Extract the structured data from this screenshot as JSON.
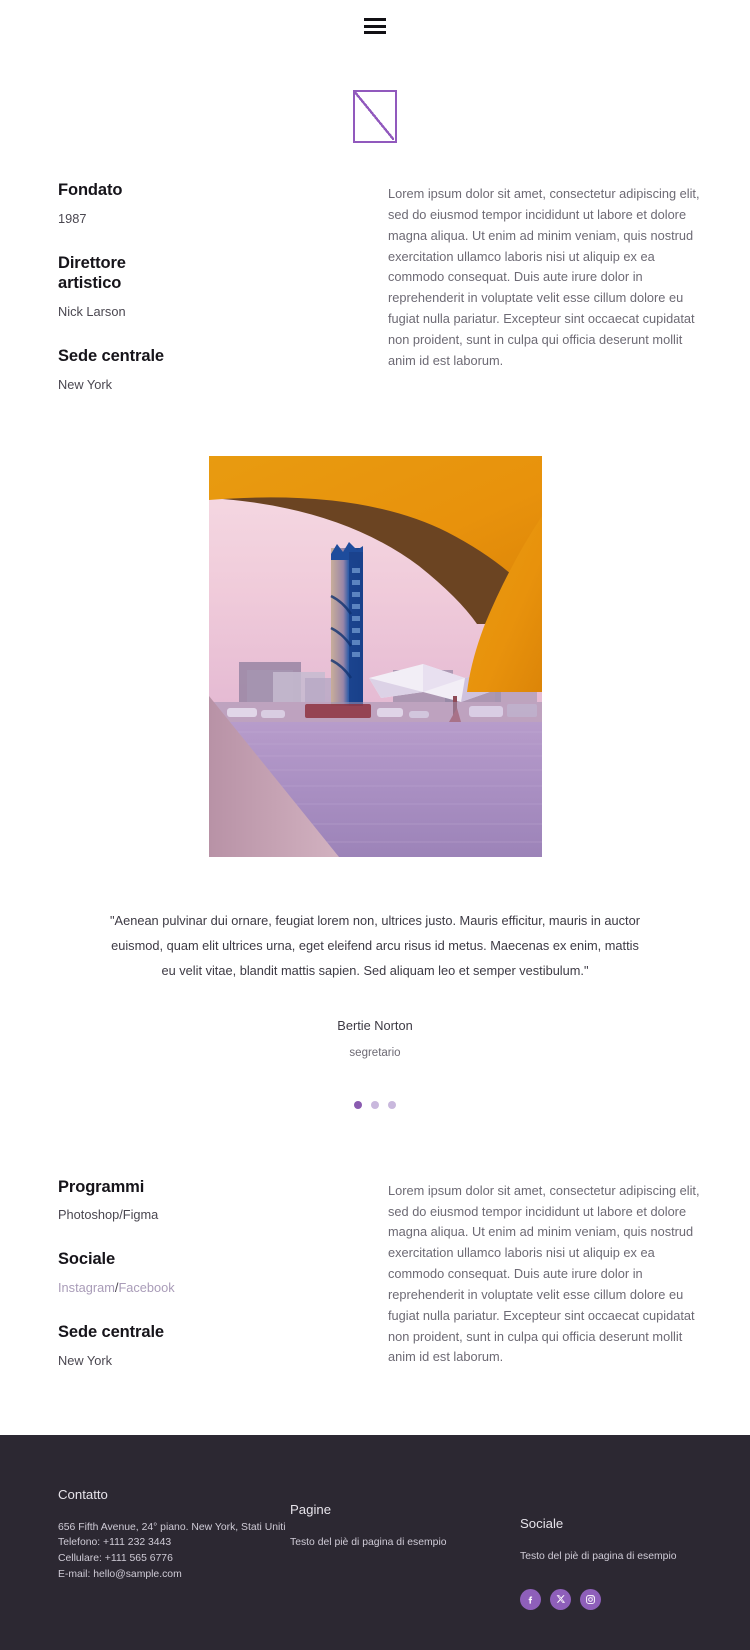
{
  "header": {
    "menu_icon": "hamburger-menu-icon"
  },
  "logo": {
    "icon": "square-diagonal-logo-mark",
    "color": "#9159bd"
  },
  "info_top": {
    "left": [
      {
        "label": "Fondato",
        "value": "1987"
      },
      {
        "label": "Direttore artistico",
        "value": "Nick Larson"
      },
      {
        "label": "Sede centrale",
        "value": "New York"
      }
    ],
    "body": "Lorem ipsum dolor sit amet, consectetur adipiscing elit, sed do eiusmod tempor incididunt ut labore et dolore magna aliqua. Ut enim ad minim veniam, quis nostrud exercitation ullamco laboris nisi ut aliquip ex ea commodo consequat. Duis aute irure dolor in reprehenderit in voluptate velit esse cillum dolore eu fugiat nulla pariatur. Excepteur sint occaecat cupidatat non proident, sunt in culpa qui officia deserunt mollit anim id est laborum."
  },
  "hero": {
    "alt": "Cityscape at sunset with blue skyscraper, waterfront and orange curved overlay",
    "colors": {
      "orange": "#E8920C",
      "dark_arc": "#5C3A1E",
      "sky_pink": "#F2D4DD",
      "tower_blue": "#1F4F9E",
      "water": "#B29AC8",
      "foreground_mauve": "#C9A8B8"
    }
  },
  "testimonial": {
    "quote": "\"Aenean pulvinar dui ornare, feugiat lorem non, ultrices justo. Mauris efficitur, mauris in auctor euismod, quam elit ultrices urna, eget eleifend arcu risus id metus. Maecenas ex enim, mattis eu velit vitae, blandit mattis sapien. Sed aliquam leo et semper vestibulum.\"",
    "author": "Bertie Norton",
    "role": "segretario",
    "dots": [
      {
        "active": true
      },
      {
        "active": false
      },
      {
        "active": false
      }
    ],
    "active_color": "#8a5bb0",
    "inactive_color": "#c9b8dd"
  },
  "info_bottom": {
    "left": [
      {
        "label": "Programmi",
        "value": "Photoshop/Figma"
      },
      {
        "label": "Sociale",
        "value": "Instagram/Facebook"
      },
      {
        "label": "Sede centrale",
        "value": "New York"
      }
    ],
    "social_links": {
      "first": "Instagram",
      "separator": "/",
      "second": "Facebook",
      "color": "#a99cb8"
    },
    "body": "Lorem ipsum dolor sit amet, consectetur adipiscing elit, sed do eiusmod tempor incididunt ut labore et dolore magna aliqua. Ut enim ad minim veniam, quis nostrud exercitation ullamco laboris nisi ut aliquip ex ea commodo consequat. Duis aute irure dolor in reprehenderit in voluptate velit esse cillum dolore eu fugiat nulla pariatur. Excepteur sint occaecat cupidatat non proident, sunt in culpa qui officia deserunt mollit anim id est laborum."
  },
  "footer": {
    "background": "#2c2832",
    "contact": {
      "title": "Contatto",
      "address": "656 Fifth Avenue, 24° piano. New York, Stati Uniti",
      "phone": "Telefono: +111 232 3443",
      "mobile": "Cellulare: +111 565 6776",
      "email": "E-mail: hello@sample.com"
    },
    "pages": {
      "title": "Pagine",
      "text": "Testo del piè di pagina di esempio"
    },
    "social": {
      "title": "Sociale",
      "text": "Testo del piè di pagina di esempio",
      "icons": [
        {
          "name": "facebook-icon"
        },
        {
          "name": "x-twitter-icon"
        },
        {
          "name": "instagram-icon"
        }
      ],
      "icon_color": "#8e5fba"
    }
  }
}
